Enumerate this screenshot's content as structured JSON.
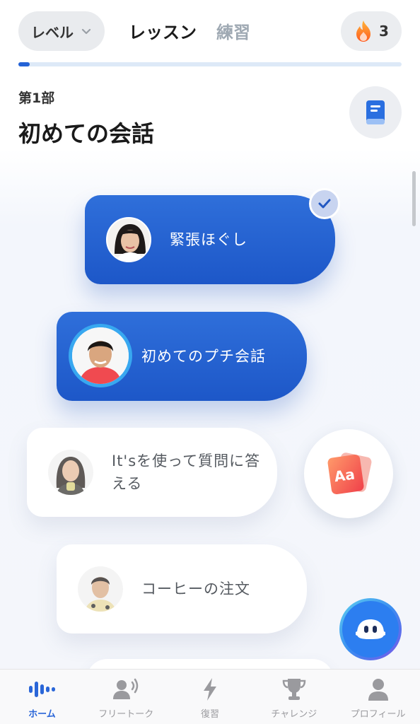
{
  "header": {
    "level_label": "レベル",
    "tabs": [
      {
        "label": "レッスン",
        "active": true
      },
      {
        "label": "練習",
        "active": false
      }
    ],
    "streak_count": "3",
    "progress_fraction": 0.03
  },
  "section": {
    "part": "第1部",
    "title": "初めての会話"
  },
  "lessons": [
    {
      "title": "緊張ほぐし",
      "state": "completed"
    },
    {
      "title": "初めてのプチ会話",
      "state": "current"
    },
    {
      "title": "It'sを使って質問に答える",
      "state": "locked"
    },
    {
      "title": "コーヒーの注文",
      "state": "locked"
    }
  ],
  "flashcard_icon_text": "Aa",
  "nav": [
    {
      "label": "ホーム",
      "icon": "home-wave-icon",
      "active": true
    },
    {
      "label": "フリートーク",
      "icon": "free-talk-icon",
      "active": false
    },
    {
      "label": "復習",
      "icon": "lightning-icon",
      "active": false
    },
    {
      "label": "チャレンジ",
      "icon": "trophy-icon",
      "active": false
    },
    {
      "label": "プロフィール",
      "icon": "profile-icon",
      "active": false
    }
  ],
  "colors": {
    "accent": "#2463d6",
    "card_blue": "#1d57c8",
    "inactive_tab": "#9fa9b3"
  }
}
